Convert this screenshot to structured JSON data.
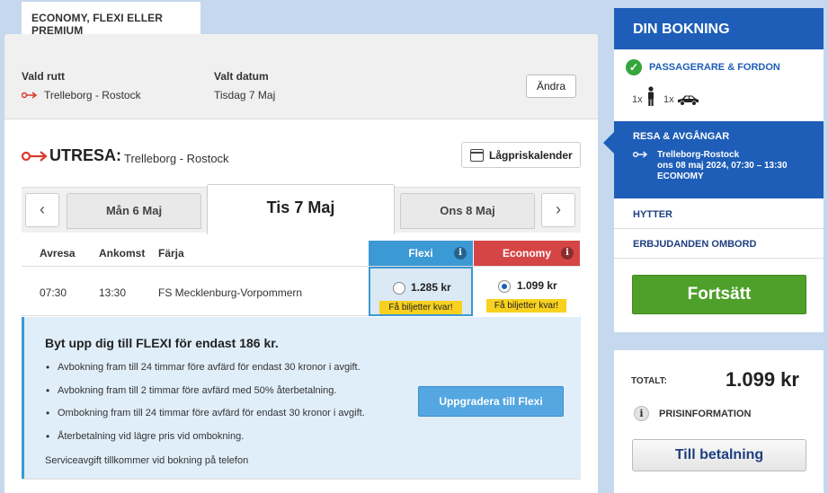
{
  "top_tab": {
    "label": "ECONOMY, FLEXI ELLER PREMIUM"
  },
  "route_bar": {
    "route_label": "Vald rutt",
    "route_value": "Trelleborg - Rostock",
    "date_label": "Valt datum",
    "date_value": "Tisdag 7 Maj",
    "change_button": "Ändra"
  },
  "outward": {
    "title": "UTRESA:",
    "route": "Trelleborg - Rostock",
    "lowprice_button": "Lågpriskalender"
  },
  "date_strip": {
    "prev_icon": "chevron-left-icon",
    "next_icon": "chevron-right-icon",
    "prev_day": "Mån 6 Maj",
    "current_day": "Tis 7 Maj",
    "next_day": "Ons 8 Maj"
  },
  "table": {
    "headers": {
      "depart": "Avresa",
      "arrive": "Ankomst",
      "ferry": "Färja",
      "flexi": "Flexi",
      "economy": "Economy"
    },
    "row": {
      "depart": "07:30",
      "arrive": "13:30",
      "ferry": "FS Mecklenburg-Vorpommern",
      "flexi_price": "1.285 kr",
      "flexi_badge": "Få biljetter kvar!",
      "economy_price": "1.099 kr",
      "economy_badge": "Få biljetter kvar!",
      "selected": "economy"
    }
  },
  "upsell": {
    "title": "Byt upp dig till FLEXI för endast 186 kr.",
    "items": [
      "Avbokning fram till 24 timmar före avfärd för endast 30 kronor i avgift.",
      "Avbokning fram till 2 timmar före avfärd med 50% återbetalning.",
      "Ombokning fram till 24 timmar före avfärd för endast 30 kronor i avgift.",
      "Återbetalning vid lägre pris vid ombokning."
    ],
    "note": "Serviceavgift tillkommer vid bokning på telefon",
    "button": "Uppgradera till Flexi"
  },
  "booking": {
    "title": "DIN BOKNING",
    "step1": {
      "label": "PASSAGERARE & FORDON",
      "pax_count": "1x",
      "vehicle_count": "1x"
    },
    "step2": {
      "label": "RESA & AVGÅNGAR",
      "route": "Trelleborg-Rostock",
      "time": "ons 08 maj 2024, 07:30 – 13:30",
      "class": "ECONOMY"
    },
    "step3": {
      "label": "HYTTER"
    },
    "step4": {
      "label": "ERBJUDANDEN OMBORD"
    },
    "continue_button": "Fortsätt"
  },
  "total": {
    "label": "TOTALT:",
    "value": "1.099 kr",
    "info_label": "PRISINFORMATION",
    "pay_button": "Till betalning"
  },
  "colors": {
    "accent_blue": "#1e5eb8",
    "flexi": "#3b99d4",
    "economy": "#d64545",
    "continue_green": "#4fa02a",
    "badge_yellow": "#f7d11e",
    "route_arrow_red": "#d83a2f"
  }
}
